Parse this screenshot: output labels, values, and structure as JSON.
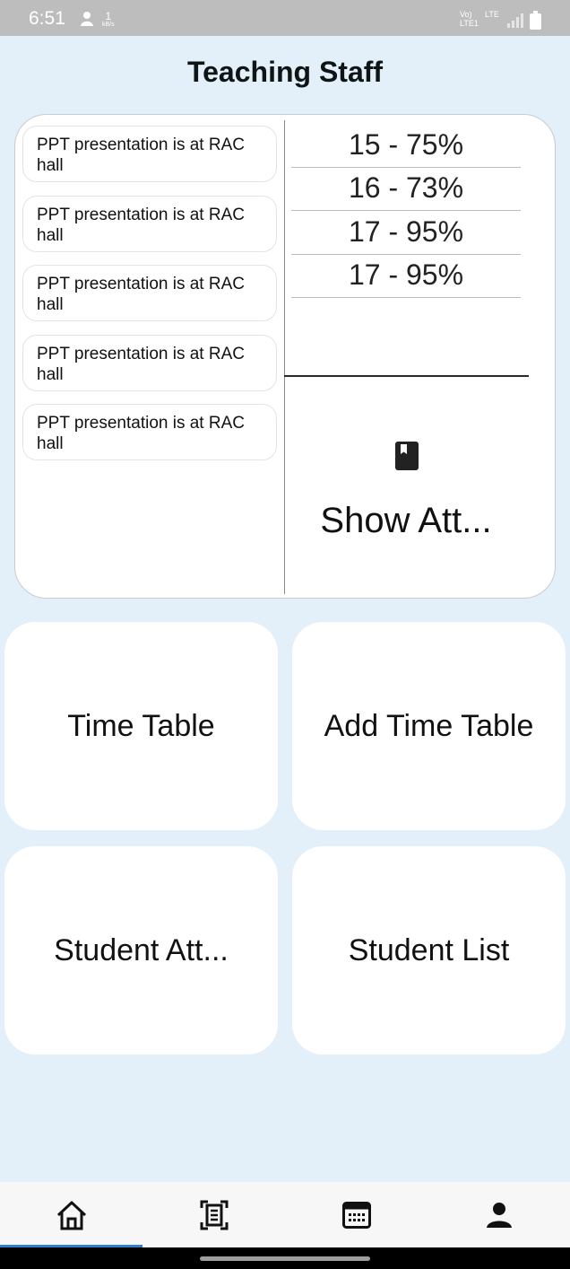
{
  "status": {
    "time": "6:51",
    "speed_value": "1",
    "speed_unit": "kB/s",
    "volte_top": "Vo)",
    "volte_bottom": "LTE1",
    "lte": "LTE"
  },
  "page": {
    "title": "Teaching Staff"
  },
  "notices": [
    {
      "text": "PPT presentation is at RAC hall"
    },
    {
      "text": "PPT presentation is at RAC hall"
    },
    {
      "text": "PPT presentation is at RAC hall"
    },
    {
      "text": "PPT presentation is at RAC hall"
    },
    {
      "text": "PPT presentation is at RAC hall"
    }
  ],
  "attendance": [
    {
      "text": "15 - 75%"
    },
    {
      "text": "16 - 73%"
    },
    {
      "text": "17 - 95%"
    },
    {
      "text": "17 - 95%"
    }
  ],
  "show_attendance": {
    "label": "Show Att...",
    "icon": "book-icon"
  },
  "cards": {
    "time_table": "Time Table",
    "add_time_table": "Add Time Table",
    "student_attendance": "Student Att...",
    "student_list": "Student List"
  },
  "nav": {
    "items": [
      {
        "icon": "home-icon"
      },
      {
        "icon": "document-scan-icon"
      },
      {
        "icon": "calendar-icon"
      },
      {
        "icon": "person-icon"
      }
    ],
    "active_index": 0,
    "accent": "#2f7fcf"
  }
}
